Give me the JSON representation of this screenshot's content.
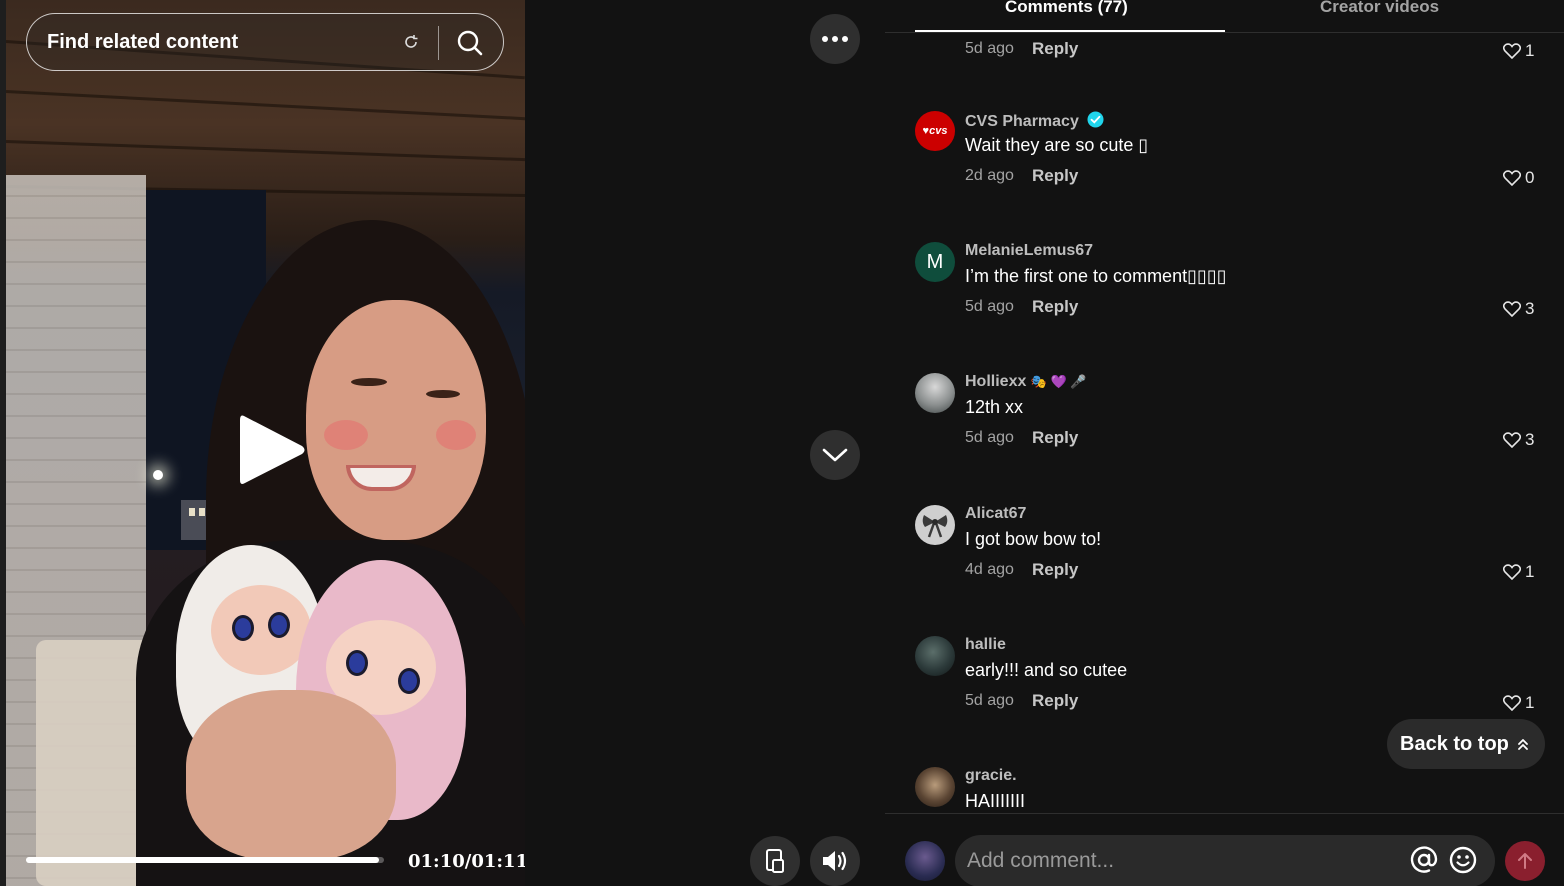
{
  "search": {
    "placeholder": "Find related content"
  },
  "video": {
    "current_time": "01:10",
    "duration": "01:11",
    "time_label": "01:10/01:11",
    "progress": 0.985
  },
  "tabs": [
    {
      "label": "Comments (77)",
      "active": true
    },
    {
      "label": "Creator videos",
      "active": false
    }
  ],
  "first_partial": {
    "time": "5d ago",
    "reply": "Reply",
    "likes": "1"
  },
  "comments": [
    {
      "user": "CVS Pharmacy",
      "verified": true,
      "text": "Wait they are so cute ▯",
      "time": "2d ago",
      "reply": "Reply",
      "likes": "0",
      "avatar_label": "♥cvs"
    },
    {
      "user": "MelanieLemus67",
      "text": "I’m the first one to comment▯▯▯▯",
      "time": "5d ago",
      "reply": "Reply",
      "likes": "3",
      "avatar_label": "M"
    },
    {
      "user": "Holliexx",
      "badges": "🎭 💜 🎤",
      "text": "12th xx",
      "time": "5d ago",
      "reply": "Reply",
      "likes": "3"
    },
    {
      "user": "Alicat67",
      "text": "I got bow bow to!",
      "time": "4d ago",
      "reply": "Reply",
      "likes": "1"
    },
    {
      "user": "hallie",
      "text": "early!!! and so cutee",
      "time": "5d ago",
      "reply": "Reply",
      "likes": "1"
    },
    {
      "user": "gracie.",
      "text": "HAIIIIIII"
    }
  ],
  "back_to_top": "Back to top",
  "input": {
    "placeholder": "Add comment..."
  },
  "colors": {
    "accent": "#fe2c55",
    "verified": "#20d5ec",
    "post_button": "#8a1f2e",
    "cvs_red": "#cc0000",
    "melanie_green": "#0f4d3c"
  }
}
